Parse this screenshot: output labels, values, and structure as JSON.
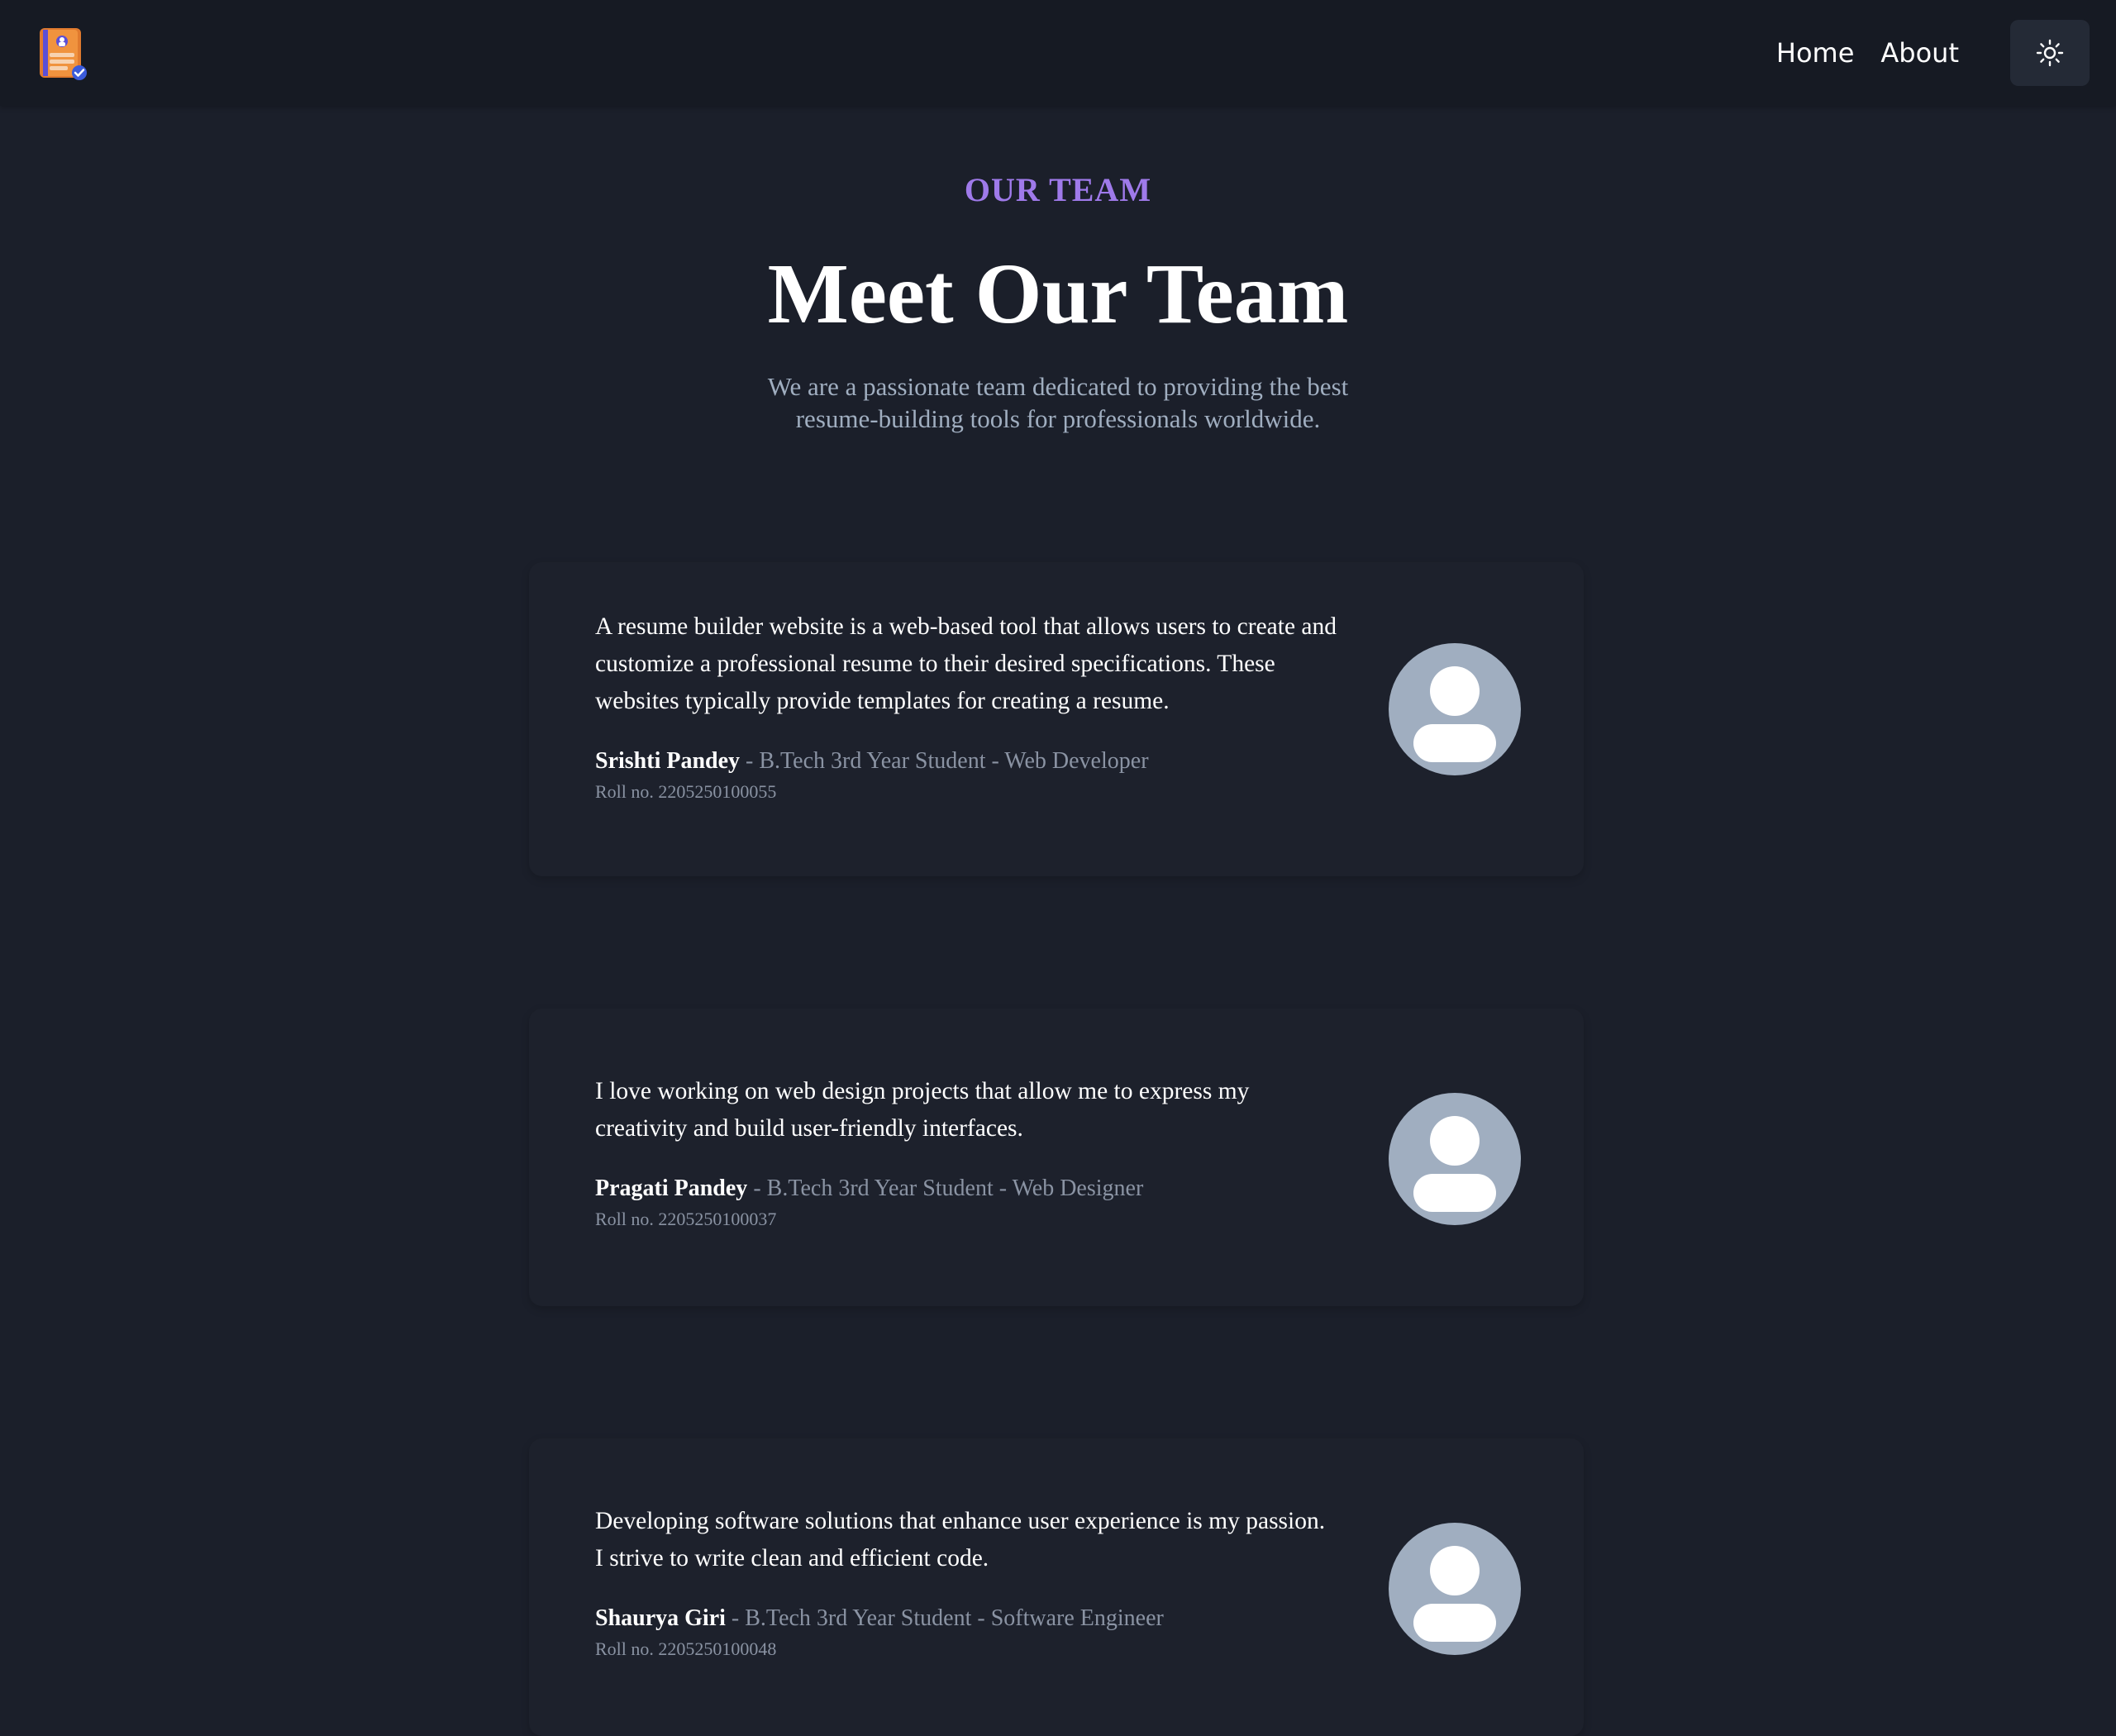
{
  "navbar": {
    "logo_icon": "resume-logo-icon",
    "links": [
      {
        "label": "Home"
      },
      {
        "label": "About"
      }
    ],
    "theme_toggle_icon": "sun-icon"
  },
  "header": {
    "eyebrow": "OUR TEAM",
    "title": "Meet Our Team",
    "subtitle": "We are a passionate team dedicated to providing the best resume-building tools for professionals worldwide."
  },
  "team": [
    {
      "quote": "A resume builder website is a web-based tool that allows users to create and customize a professional resume to their desired specifications. These websites typically provide templates for creating a resume.",
      "name": "Srishti Pandey",
      "role": "- B.Tech 3rd Year Student - Web Developer",
      "roll": "Roll no. 2205250100055",
      "avatar_icon": "user-avatar-icon"
    },
    {
      "quote": "I love working on web design projects that allow me to express my creativity and build user-friendly interfaces.",
      "name": "Pragati Pandey",
      "role": "- B.Tech 3rd Year Student - Web Designer",
      "roll": "Roll no. 2205250100037",
      "avatar_icon": "user-avatar-icon"
    },
    {
      "quote": "Developing software solutions that enhance user experience is my passion. I strive to write clean and efficient code.",
      "name": "Shaurya Giri",
      "role": "- B.Tech 3rd Year Student - Software Engineer",
      "roll": "Roll no. 2205250100048",
      "avatar_icon": "user-avatar-icon"
    }
  ],
  "colors": {
    "background": "#1b1f2a",
    "navbar": "#161a23",
    "accent": "#9f7aea",
    "muted_text": "#a0aec0",
    "avatar": "#a0aec0"
  }
}
